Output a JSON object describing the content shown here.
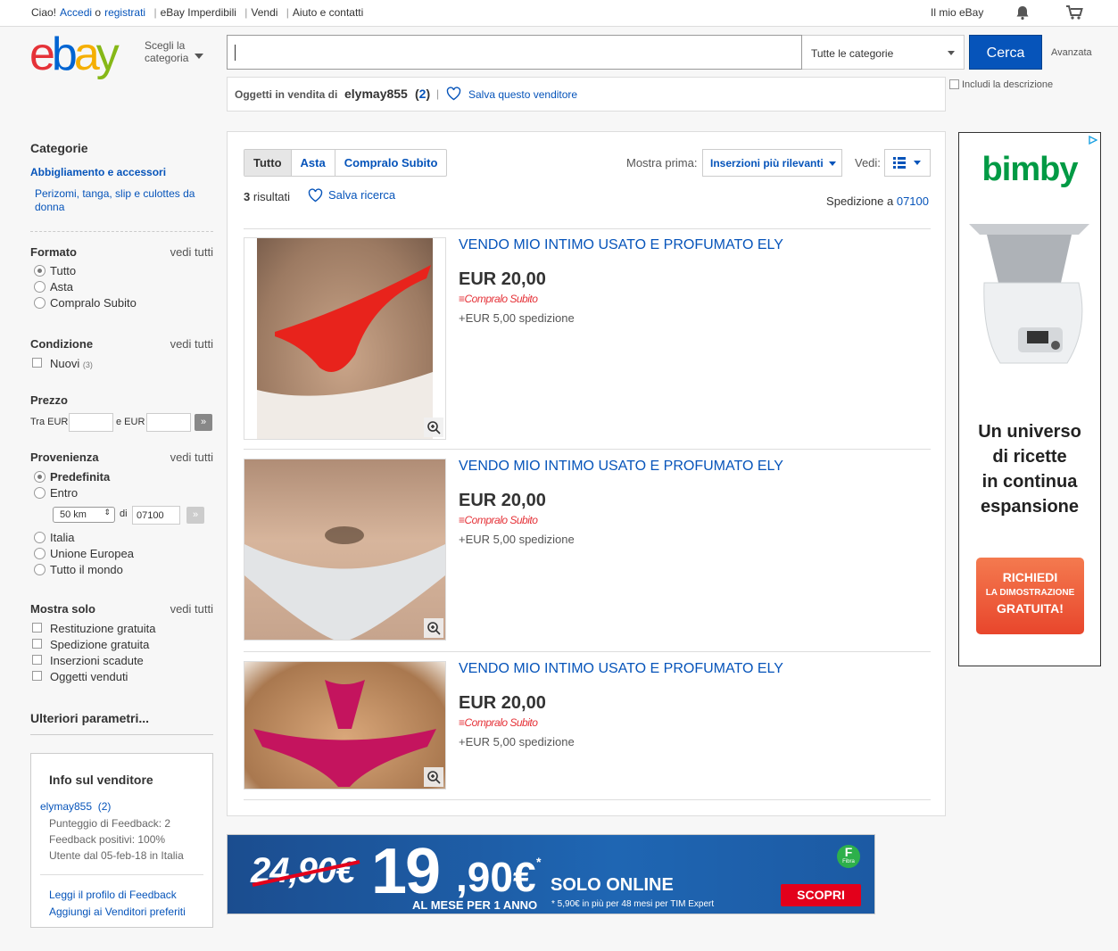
{
  "topbar": {
    "ciao": "Ciao!",
    "accedi": "Accedi",
    "o": "o",
    "registrati": "registrati",
    "imperdibili": "eBay Imperdibili",
    "vendi": "Vendi",
    "aiuto": "Aiuto e contatti",
    "mio_ebay": "Il mio eBay"
  },
  "header": {
    "logo": "ebay",
    "shop_cat_line1": "Scegli la",
    "shop_cat_line2": "categoria",
    "search_value": "",
    "category_select": "Tutte le categorie",
    "search_button": "Cerca",
    "advanced": "Avanzata",
    "include_desc": "Includi la descrizione"
  },
  "seller_bar": {
    "label": "Oggetti in vendita di",
    "username": "elymay855",
    "open_paren": "(",
    "count": "2",
    "close_paren": ")",
    "save_seller": "Salva questo venditore"
  },
  "sidebar": {
    "categorie_title": "Categorie",
    "cat1": "Abbigliamento e accessori",
    "cat2_line1": "Perizomi, tanga, slip e culottes da",
    "cat2_line2": "donna",
    "see_all": "vedi tutti",
    "formato": {
      "title": "Formato",
      "options": [
        "Tutto",
        "Asta",
        "Compralo Subito"
      ]
    },
    "condizione": {
      "title": "Condizione",
      "option": "Nuovi",
      "count": "(3)"
    },
    "prezzo": {
      "title": "Prezzo",
      "tra": "Tra EUR",
      "e": "e EUR"
    },
    "provenienza": {
      "title": "Provenienza",
      "predefinita": "Predefinita",
      "entro": "Entro",
      "km": "50 km",
      "di": "di",
      "cap": "07100",
      "options": [
        "Italia",
        "Unione Europea",
        "Tutto il mondo"
      ]
    },
    "mostra_solo": {
      "title": "Mostra solo",
      "options": [
        "Restituzione gratuita",
        "Spedizione gratuita",
        "Inserzioni scadute",
        "Oggetti venduti"
      ]
    },
    "ulteriori": "Ulteriori parametri..."
  },
  "seller_info": {
    "title": "Info sul venditore",
    "username": "elymay855",
    "count": "(2)",
    "feedback_score": "Punteggio di Feedback: 2",
    "feedback_positive": "Feedback positivi: 100%",
    "member_since": "Utente dal 05-feb-18 in Italia",
    "link_profile": "Leggi il profilo di Feedback",
    "link_fav": "Aggiungi ai Venditori preferiti"
  },
  "results": {
    "tabs": [
      "Tutto",
      "Asta",
      "Compralo Subito"
    ],
    "sort_label": "Mostra prima:",
    "sort_value": "Inserzioni più rilevanti",
    "view_label": "Vedi:",
    "count": "3",
    "count_label": "risultati",
    "save_search": "Salva ricerca",
    "shipping_to": "Spedizione a",
    "zip": "07100",
    "items": [
      {
        "title": "VENDO MIO INTIMO USATO E PROFUMATO ELY",
        "price": "EUR 20,00",
        "format": "Compralo Subito",
        "shipping": "+EUR 5,00 spedizione",
        "color": "#e8231c"
      },
      {
        "title": "VENDO MIO INTIMO USATO E PROFUMATO ELY",
        "price": "EUR 20,00",
        "format": "Compralo Subito",
        "shipping": "+EUR 5,00 spedizione",
        "color": "#e2e4e6"
      },
      {
        "title": "VENDO MIO INTIMO USATO E PROFUMATO ELY",
        "price": "EUR 20,00",
        "format": "Compralo Subito",
        "shipping": "+EUR 5,00 spedizione",
        "color": "#c4145e"
      }
    ]
  },
  "ad_right": {
    "brand": "bimby",
    "line1": "Un universo",
    "line2": "di ricette",
    "line3": "in continua",
    "line4": "espansione",
    "cta1": "RICHIEDI",
    "cta2": "LA DIMOSTRAZIONE",
    "cta3": "GRATUITA!"
  },
  "ad_banner": {
    "old_price": "24,90€",
    "new_int": "19",
    "new_dec": ",90€",
    "asterisk": "*",
    "solo": "SOLO ONLINE",
    "al_mese": "AL MESE PER 1 ANNO",
    "note": "* 5,90€ in più per 48 mesi per TIM Expert",
    "button": "SCOPRI",
    "badge_letter": "F",
    "badge_word": "Fibra"
  }
}
